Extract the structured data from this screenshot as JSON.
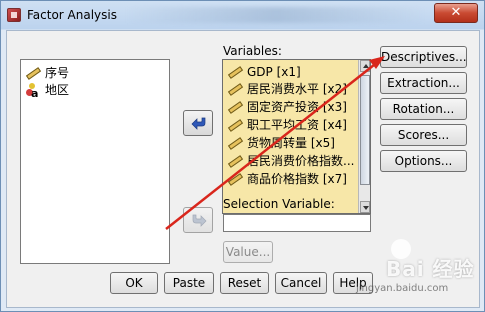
{
  "window": {
    "title": "Factor Analysis",
    "close_label": "✕"
  },
  "source_list": {
    "items": [
      {
        "label": "序号",
        "icon": "scale-ruler-icon"
      },
      {
        "label": "地区",
        "icon": "nominal-string-icon"
      }
    ]
  },
  "variables": {
    "label": "Variables:",
    "items": [
      "GDP [x1]",
      "居民消费水平 [x2]",
      "固定资产投资 [x3]",
      "职工平均工资 [x4]",
      "货物周转量 [x5]",
      "居民消费价格指数...",
      "商品价格指数 [x7]"
    ]
  },
  "selection": {
    "label": "Selection Variable:",
    "value": "",
    "value_button": "Value..."
  },
  "side_buttons": {
    "descriptives": "Descriptives...",
    "extraction": "Extraction...",
    "rotation": "Rotation...",
    "scores": "Scores...",
    "options": "Options..."
  },
  "bottom_buttons": {
    "ok": "OK",
    "paste": "Paste",
    "reset": "Reset",
    "cancel": "Cancel",
    "help": "Help"
  },
  "watermark": {
    "text": "Bai 经验",
    "url": "jingyan.baidu.com"
  },
  "colors": {
    "annotation_arrow": "#d9261c",
    "variables_background": "#f7e7a8",
    "move_arrow": "#2f58b8"
  }
}
